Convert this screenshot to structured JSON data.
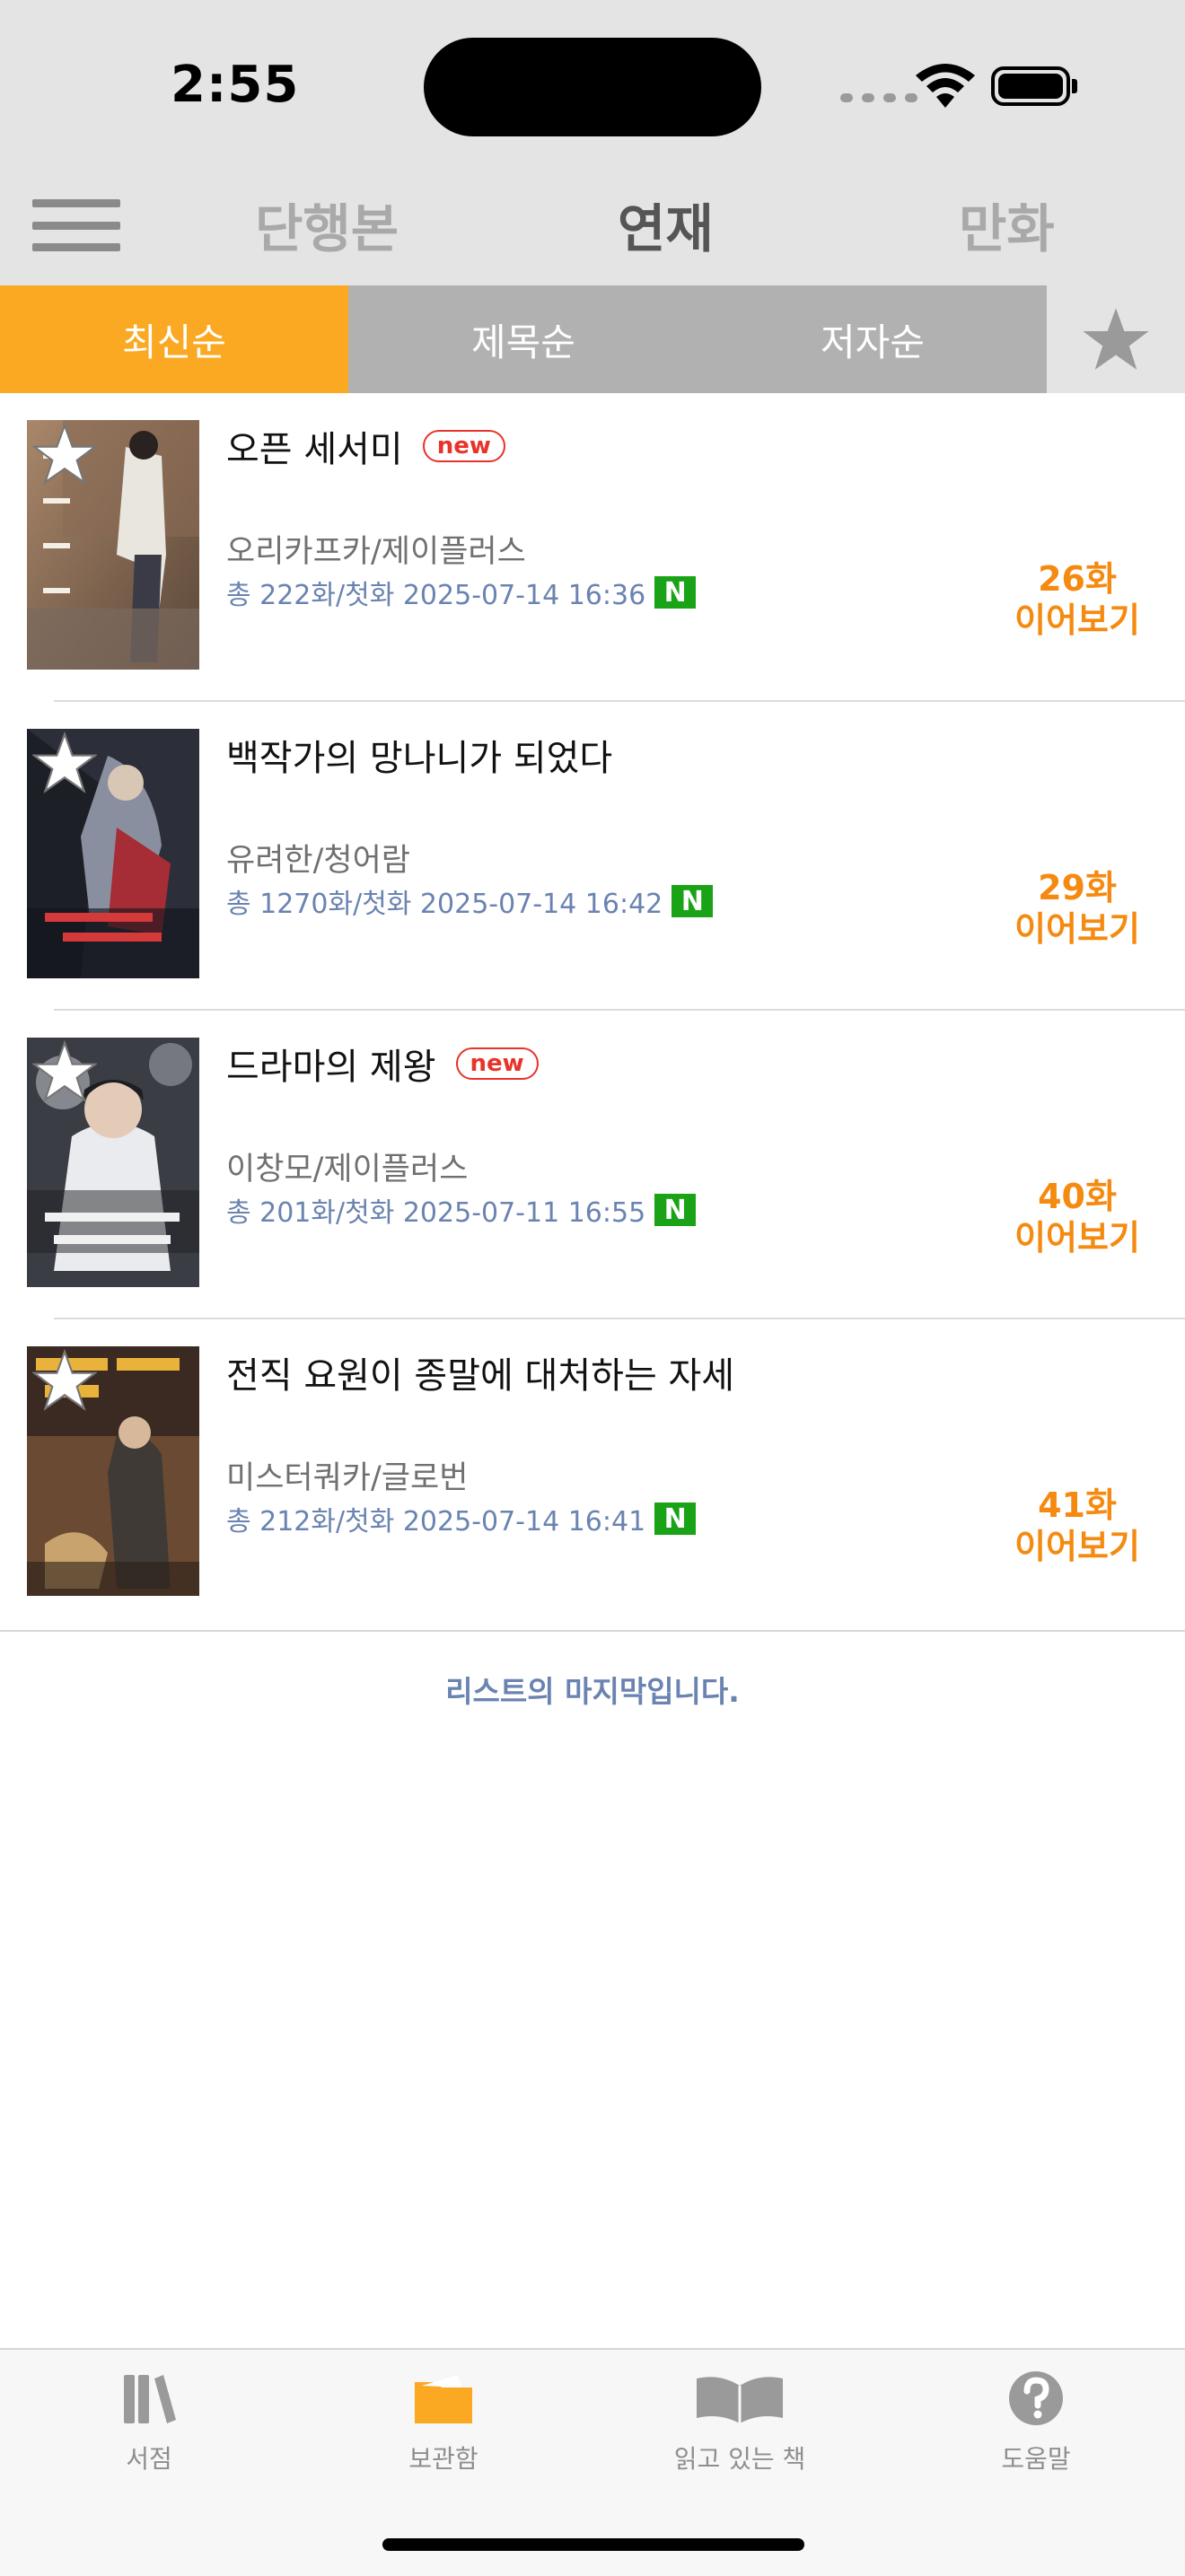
{
  "status": {
    "time": "2:55"
  },
  "nav": {
    "tabs": [
      "단행본",
      "연재",
      "만화"
    ],
    "active": 1
  },
  "sort": {
    "tabs": [
      "최신순",
      "제목순",
      "저자순"
    ],
    "active": 0,
    "accent": "#fba822",
    "inactive": "#b1b1b1"
  },
  "books": [
    {
      "title": "오픈 세서미",
      "new": "new",
      "author": "오리카프카/제이플러스",
      "info": "총 222화/첫화 2025-07-14 16:36",
      "n": "N",
      "episode": "26화",
      "continue": "이어보기"
    },
    {
      "title": "백작가의 망나니가 되었다",
      "new": "",
      "author": "유려한/청어람",
      "info": "총 1270화/첫화 2025-07-14 16:42",
      "n": "N",
      "episode": "29화",
      "continue": "이어보기"
    },
    {
      "title": "드라마의 제왕",
      "new": "new",
      "author": "이창모/제이플러스",
      "info": "총 201화/첫화 2025-07-11 16:55",
      "n": "N",
      "episode": "40화",
      "continue": "이어보기"
    },
    {
      "title": "전직 요원이 종말에 대처하는 자세",
      "new": "",
      "author": "미스터쿼카/글로번",
      "info": "총 212화/첫화 2025-07-14 16:41",
      "n": "N",
      "episode": "41화",
      "continue": "이어보기"
    }
  ],
  "end_message": "리스트의 마지막입니다.",
  "tabbar": {
    "items": [
      {
        "label": "서점",
        "icon": "books-icon"
      },
      {
        "label": "보관함",
        "icon": "folder-icon"
      },
      {
        "label": "읽고 있는 책",
        "icon": "open-book-icon"
      },
      {
        "label": "도움말",
        "icon": "help-icon"
      }
    ],
    "active": 1,
    "active_color": "#fba822"
  }
}
